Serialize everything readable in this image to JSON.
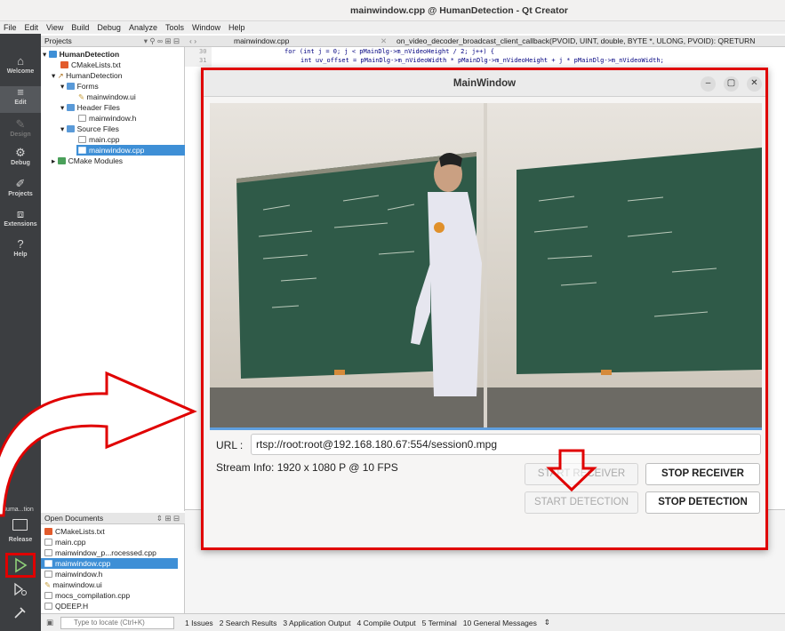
{
  "window_title": "mainwindow.cpp @ HumanDetection - Qt Creator",
  "menu": [
    "File",
    "Edit",
    "View",
    "Build",
    "Debug",
    "Analyze",
    "Tools",
    "Window",
    "Help"
  ],
  "modes": [
    {
      "label": "Welcome",
      "icon": "⌂"
    },
    {
      "label": "Edit",
      "icon": "≡"
    },
    {
      "label": "Design",
      "icon": "✎"
    },
    {
      "label": "Debug",
      "icon": "⚙"
    },
    {
      "label": "Projects",
      "icon": "✐"
    },
    {
      "label": "Extensions",
      "icon": "⧈"
    },
    {
      "label": "Help",
      "icon": "?"
    }
  ],
  "kit": {
    "name": "Huma...tion",
    "config": "Release"
  },
  "projects_header": "Projects",
  "tree": [
    {
      "label": "HumanDetection",
      "bold": true
    },
    {
      "label": "CMakeLists.txt"
    },
    {
      "label": "HumanDetection"
    },
    {
      "label": "Forms"
    },
    {
      "label": "mainwindow.ui"
    },
    {
      "label": "Header Files"
    },
    {
      "label": "mainwindow.h"
    },
    {
      "label": "Source Files"
    },
    {
      "label": "main.cpp"
    },
    {
      "label": "mainwindow.cpp",
      "selected": true
    },
    {
      "label": "CMake Modules"
    }
  ],
  "editor": {
    "file_tab": "mainwindow.cpp",
    "function": "on_video_decoder_broadcast_client_callback(PVOID, UINT, double, BYTE *, ULONG, PVOID): QRETURN",
    "line_numbers": [
      "30",
      "31"
    ],
    "code_lines": [
      "for (int j = 0; j < pMainDlg->m_nVideoHeight / 2; j++) {",
      "int uv_offset = pMainDlg->m_nVideoWidth * pMainDlg->m_nVideoHeight + j * pMainDlg->m_nVideoWidth;"
    ]
  },
  "open_documents": {
    "header": "Open Documents",
    "items": [
      "CMakeLists.txt",
      "main.cpp",
      "mainwindow_p...rocessed.cpp",
      "mainwindow.cpp",
      "mainwindow.h",
      "mainwindow.ui",
      "mocs_compilation.cpp",
      "QDEEP.H"
    ],
    "selected": "mainwindow.cpp"
  },
  "locator_placeholder": "Type to locate (Ctrl+K)",
  "output_tabs": [
    "1 Issues",
    "2 Search Results",
    "3 Application Output",
    "4 Compile Output",
    "5 Terminal",
    "10 General Messages"
  ],
  "dialog": {
    "title": "MainWindow",
    "url_label": "URL :",
    "url_value": "rtsp://root:root@192.168.180.67:554/session0.mpg",
    "stream_info": "Stream Info: 1920 x 1080 P  @ 10 FPS",
    "buttons": {
      "start_receiver": "START RECEIVER",
      "stop_receiver": "STOP RECEIVER",
      "start_detection": "START DETECTION",
      "stop_detection": "STOP DETECTION"
    }
  },
  "colors": {
    "annotation": "#e00000",
    "selection": "#3e8fd6",
    "modebar": "#3c3e41"
  }
}
